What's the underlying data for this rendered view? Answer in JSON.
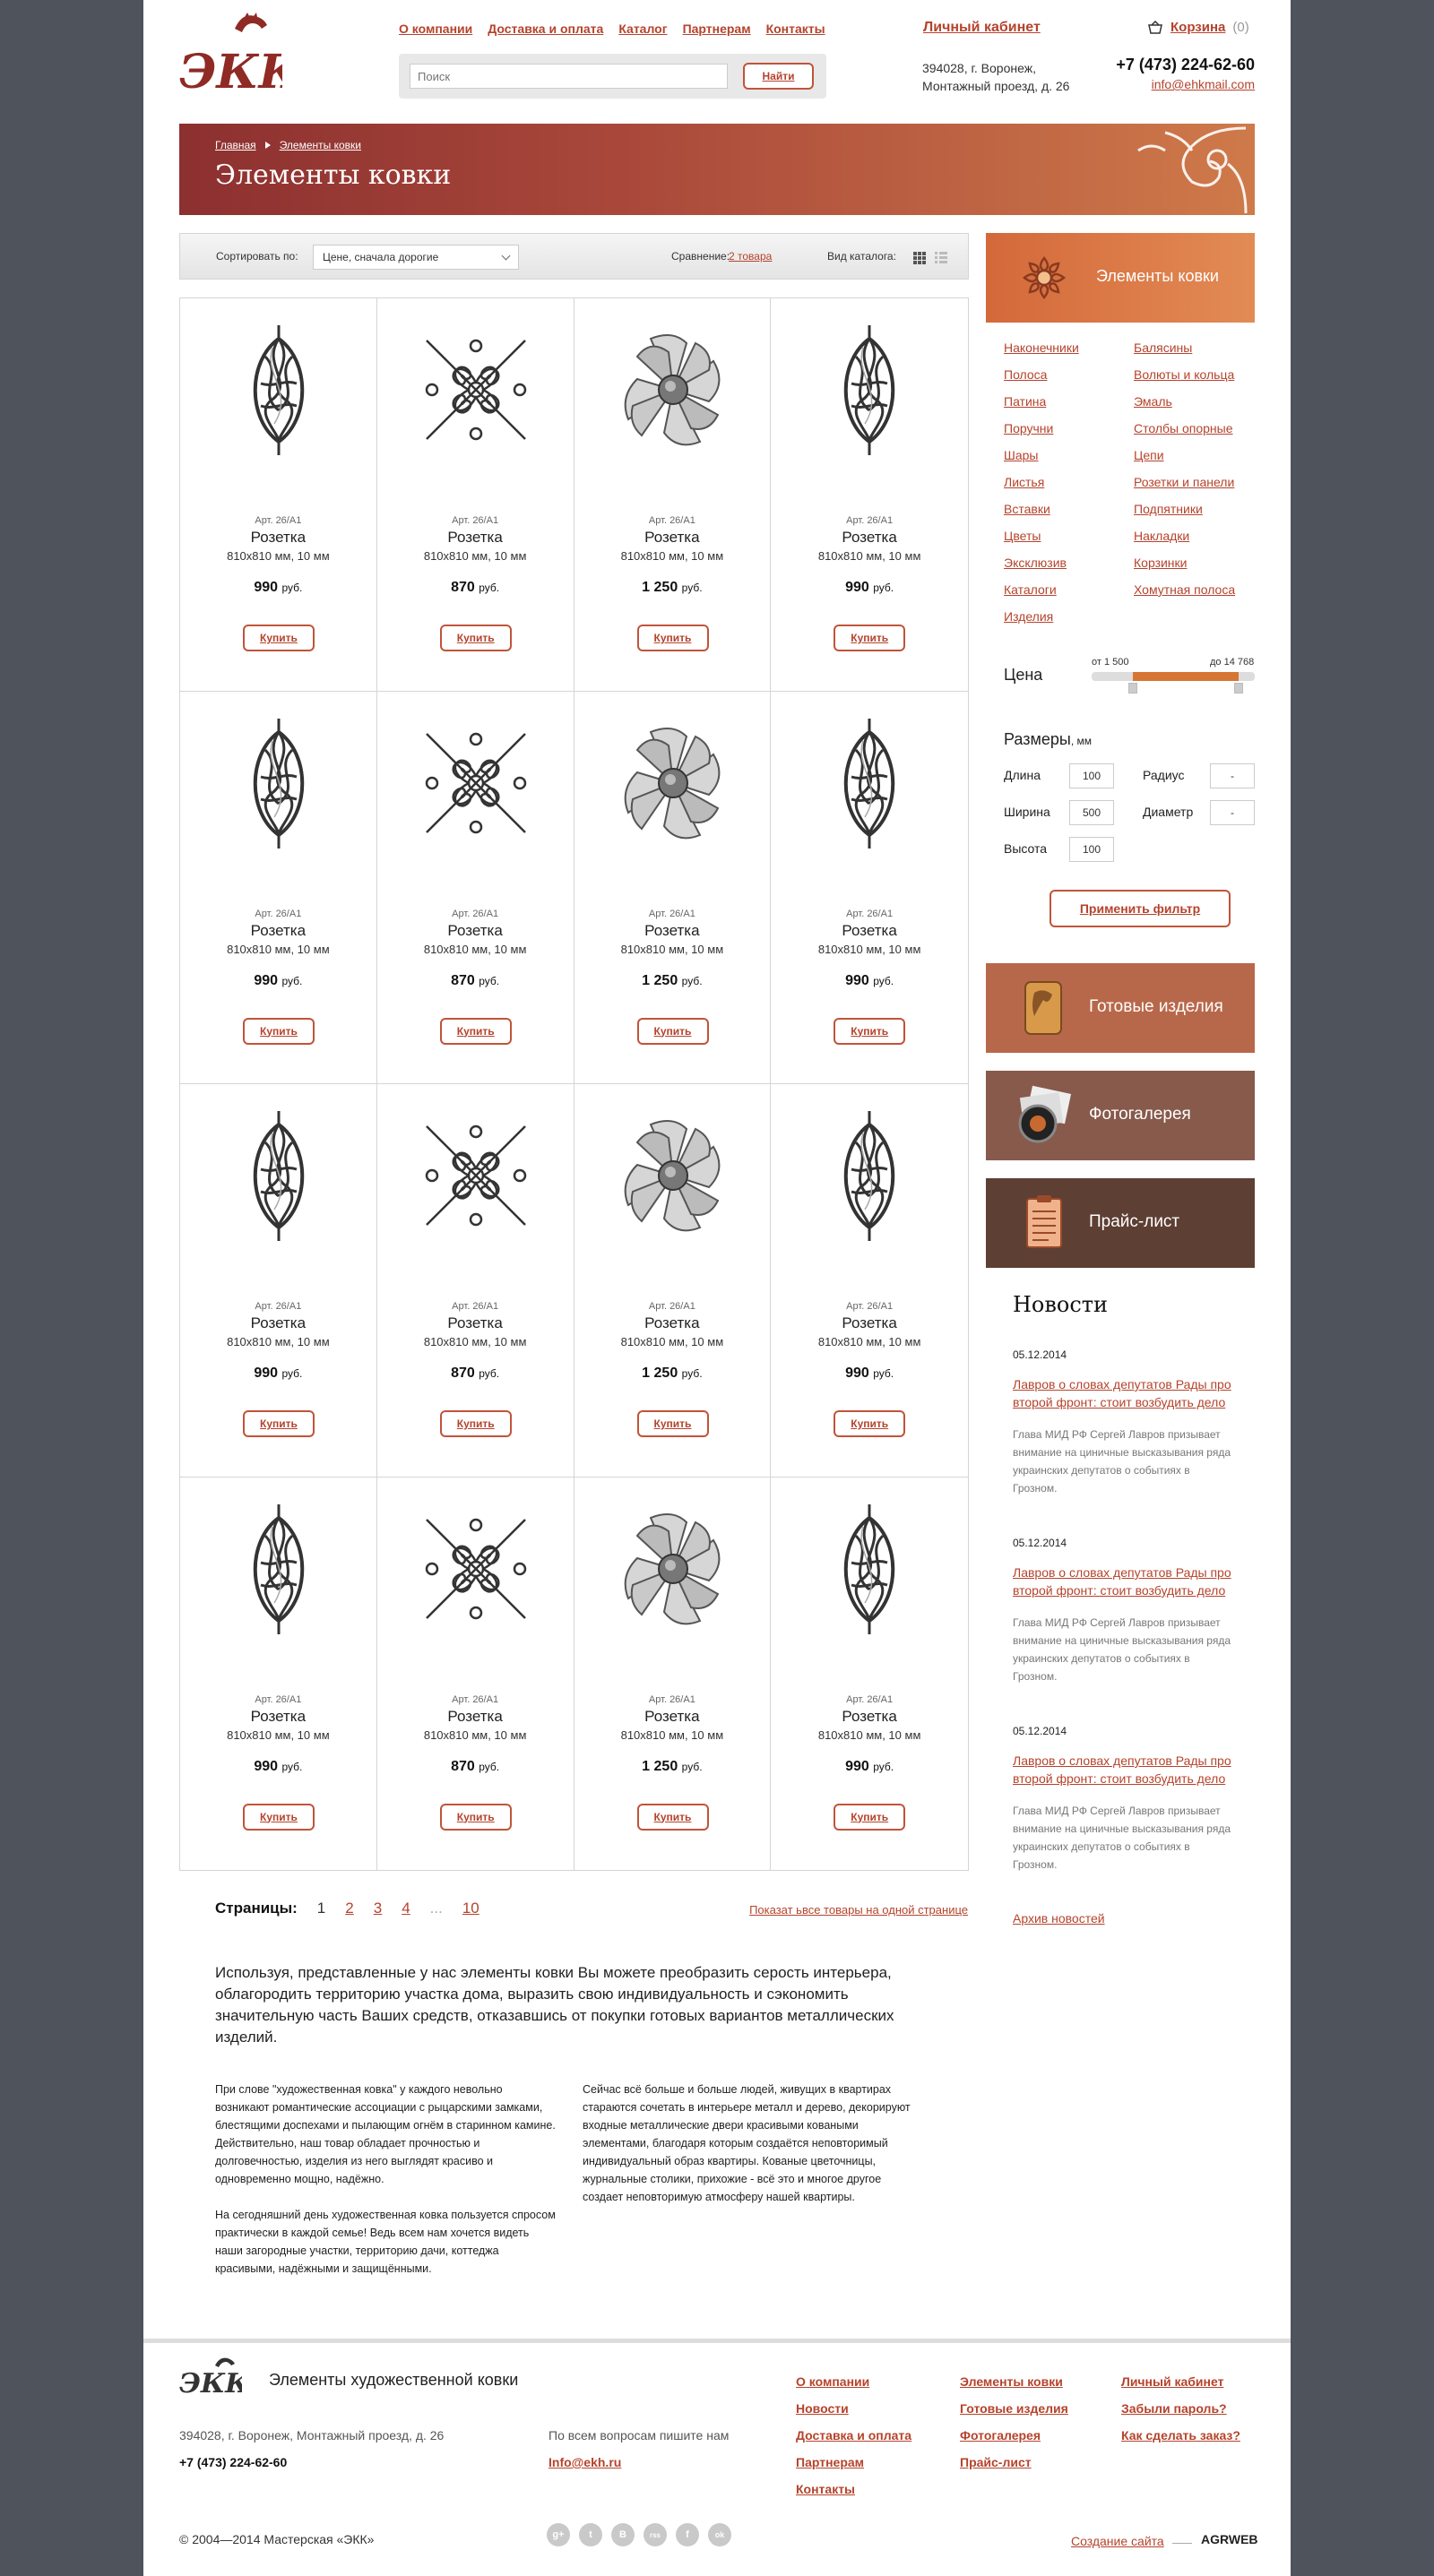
{
  "header": {
    "logo_text": "ЭКК",
    "nav": [
      "О компании",
      "Доставка и оплата",
      "Каталог",
      "Партнерам",
      "Контакты"
    ],
    "search_placeholder": "Поиск",
    "search_button": "Найти",
    "cabinet": "Личный кабинет",
    "cart_label": "Корзина",
    "cart_count": "(0)",
    "address_line1": "394028, г. Воронеж,",
    "address_line2": "Монтажный проезд, д. 26",
    "phone": "+7 (473) 224-62-60",
    "email": "info@ehkmail.com"
  },
  "banner": {
    "breadcrumb": [
      "Главная",
      "Элементы ковки"
    ],
    "title": "Элементы ковки"
  },
  "sortbar": {
    "sort_label": "Сортировать по:",
    "sort_value": "Цене, сначала дорогие",
    "compare_label": "Сравнение:",
    "compare_value": "2 товара",
    "view_label": "Вид каталога:"
  },
  "products": [
    {
      "type": "twist",
      "art": "Арт. 26/А1",
      "name": "Розетка",
      "size": "810х810 мм, 10 мм",
      "price": "990",
      "currency": "руб.",
      "buy": "Купить"
    },
    {
      "type": "scroll",
      "art": "Арт. 26/А1",
      "name": "Розетка",
      "size": "810х810 мм, 10 мм",
      "price": "870",
      "currency": "руб.",
      "buy": "Купить"
    },
    {
      "type": "flower",
      "art": "Арт. 26/А1",
      "name": "Розетка",
      "size": "810х810 мм, 10 мм",
      "price": "1 250",
      "currency": "руб.",
      "buy": "Купить"
    },
    {
      "type": "twist",
      "art": "Арт. 26/А1",
      "name": "Розетка",
      "size": "810х810 мм, 10 мм",
      "price": "990",
      "currency": "руб.",
      "buy": "Купить"
    },
    {
      "type": "twist",
      "art": "Арт. 26/А1",
      "name": "Розетка",
      "size": "810х810 мм, 10 мм",
      "price": "990",
      "currency": "руб.",
      "buy": "Купить"
    },
    {
      "type": "scroll",
      "art": "Арт. 26/А1",
      "name": "Розетка",
      "size": "810х810 мм, 10 мм",
      "price": "870",
      "currency": "руб.",
      "buy": "Купить"
    },
    {
      "type": "flower",
      "art": "Арт. 26/А1",
      "name": "Розетка",
      "size": "810х810 мм, 10 мм",
      "price": "1 250",
      "currency": "руб.",
      "buy": "Купить"
    },
    {
      "type": "twist",
      "art": "Арт. 26/А1",
      "name": "Розетка",
      "size": "810х810 мм, 10 мм",
      "price": "990",
      "currency": "руб.",
      "buy": "Купить"
    },
    {
      "type": "twist",
      "art": "Арт. 26/А1",
      "name": "Розетка",
      "size": "810х810 мм, 10 мм",
      "price": "990",
      "currency": "руб.",
      "buy": "Купить"
    },
    {
      "type": "scroll",
      "art": "Арт. 26/А1",
      "name": "Розетка",
      "size": "810х810 мм, 10 мм",
      "price": "870",
      "currency": "руб.",
      "buy": "Купить"
    },
    {
      "type": "flower",
      "art": "Арт. 26/А1",
      "name": "Розетка",
      "size": "810х810 мм, 10 мм",
      "price": "1 250",
      "currency": "руб.",
      "buy": "Купить"
    },
    {
      "type": "twist",
      "art": "Арт. 26/А1",
      "name": "Розетка",
      "size": "810х810 мм, 10 мм",
      "price": "990",
      "currency": "руб.",
      "buy": "Купить"
    },
    {
      "type": "twist",
      "art": "Арт. 26/А1",
      "name": "Розетка",
      "size": "810х810 мм, 10 мм",
      "price": "990",
      "currency": "руб.",
      "buy": "Купить"
    },
    {
      "type": "scroll",
      "art": "Арт. 26/А1",
      "name": "Розетка",
      "size": "810х810 мм, 10 мм",
      "price": "870",
      "currency": "руб.",
      "buy": "Купить"
    },
    {
      "type": "flower",
      "art": "Арт. 26/А1",
      "name": "Розетка",
      "size": "810х810 мм, 10 мм",
      "price": "1 250",
      "currency": "руб.",
      "buy": "Купить"
    },
    {
      "type": "twist",
      "art": "Арт. 26/А1",
      "name": "Розетка",
      "size": "810х810 мм, 10 мм",
      "price": "990",
      "currency": "руб.",
      "buy": "Купить"
    }
  ],
  "pager": {
    "label": "Страницы:",
    "current": "1",
    "pages": [
      "2",
      "3",
      "4"
    ],
    "dots": "...",
    "last": "10",
    "show_all": "Показат ьвсе товары на одной странице"
  },
  "text": {
    "intro": "Используя, представленные у нас элементы ковки Вы можете преобразить серость интерьера, облагородить территорию участка дома, выразить свою индивидуальность и сэкономить значительную часть Ваших средств, отказавшись от покупки готовых вариантов металлических изделий.",
    "col1_p1": "При слове \"художественная ковка\" у каждого невольно возникают романтические ассоциации с рыцарскими замками, блестящими доспехами и пылающим огнём в старинном камине. Действительно, наш товар обладает прочностью и долговечностью, изделия из него выглядят красиво и одновременно мощно, надёжно.",
    "col1_p2": "На сегодняшний день художественная ковка пользуется спросом практически в каждой семье! Ведь всем нам хочется видеть наши загородные участки, территорию дачи, коттеджа красивыми, надёжными и защищёнными.",
    "col2_p1": "Сейчас всё больше и больше людей, живущих в квартирах стараются сочетать в интерьере металл и дерево, декорируют входные металлические двери красивыми коваными элементами, благодаря которым создаётся неповторимый индивидуальный образ квартиры. Кованые цветочницы, журнальные столики, прихожие - всё это и многое другое создает неповторимую атмосферу нашей квартиры."
  },
  "sidebar": {
    "head_title": "Элементы ковки",
    "categories": [
      "Наконечники",
      "Балясины",
      "Полоса",
      "Волюты и кольца",
      "Патина",
      "Эмаль",
      "Поручни",
      "Столбы опорные",
      "Шары",
      "Цепи",
      "Листья",
      "Розетки и панели",
      "Вставки",
      "Подпятники",
      "Цветы",
      "Накладки",
      "Эксклюзив",
      "Корзинки",
      "Каталоги",
      "Хомутная полоса",
      "Изделия"
    ],
    "price_label": "Цена",
    "price_min": "от 1 500",
    "price_max": "до 14 768",
    "price_range_low": 0.25,
    "price_range_high": 0.9,
    "sizes_label": "Размеры",
    "sizes_unit": ", мм",
    "length_label": "Длина",
    "length_value": "100",
    "width_label": "Ширина",
    "width_value": "500",
    "height_label": "Высота",
    "height_value": "100",
    "radius_label": "Радиус",
    "radius_value": "-",
    "diameter_label": "Диаметр",
    "diameter_value": "-",
    "apply": "Применить фильтр",
    "promo1": "Готовые изделия",
    "promo2": "Фотогалерея",
    "promo3": "Прайс-лист",
    "promo_colors": [
      "#b8684a",
      "#875a4c",
      "#5e3f33"
    ]
  },
  "news": {
    "title": "Новости",
    "items": [
      {
        "date": "05.12.2014",
        "headline": "Лавров о словах депутатов Рады про второй фронт: стоит возбудить дело",
        "body": "Глава МИД РФ Сергей Лавров призывает внимание на циничные высказывания ряда украинских депутатов о событиях в Грозном."
      },
      {
        "date": "05.12.2014",
        "headline": "Лавров о словах депутатов Рады про второй фронт: стоит возбудить дело",
        "body": "Глава МИД РФ Сергей Лавров призывает внимание на циничные высказывания ряда украинских депутатов о событиях в Грозном."
      },
      {
        "date": "05.12.2014",
        "headline": "Лавров о словах депутатов Рады про второй фронт: стоит возбудить дело",
        "body": "Глава МИД РФ Сергей Лавров призывает внимание на циничные высказывания ряда украинских депутатов о событиях в Грозном."
      }
    ],
    "archive": "Архив новостей"
  },
  "footer": {
    "title": "Элементы художественной ковки",
    "address": "394028, г. Воронеж, Монтажный проезд, д. 26",
    "phone": "+7 (473) 224-62-60",
    "ask": "По всем вопросам пишите нам",
    "email": "Info@ekh.ru",
    "col1": [
      "О компании",
      "Новости",
      "Доставка и оплата",
      "Партнерам",
      "Контакты"
    ],
    "col2": [
      "Элементы ковки",
      "Готовые изделия",
      "Фотогалерея",
      "Прайс-лист"
    ],
    "col3": [
      "Личный кабинет",
      "Забыли пароль?",
      "Как сделать заказ?"
    ],
    "copyright": "© 2004—2014 Мастерская «ЭКК»",
    "socials": [
      "g+",
      "t",
      "B",
      "rss",
      "f",
      "ok"
    ],
    "made_by": "Создание сайта",
    "agency": "AGRWEB"
  },
  "colors": {
    "accent": "#b5432c",
    "banner_start": "#8c3030",
    "banner_end": "#cf7a4a",
    "background": "#4f535c"
  }
}
